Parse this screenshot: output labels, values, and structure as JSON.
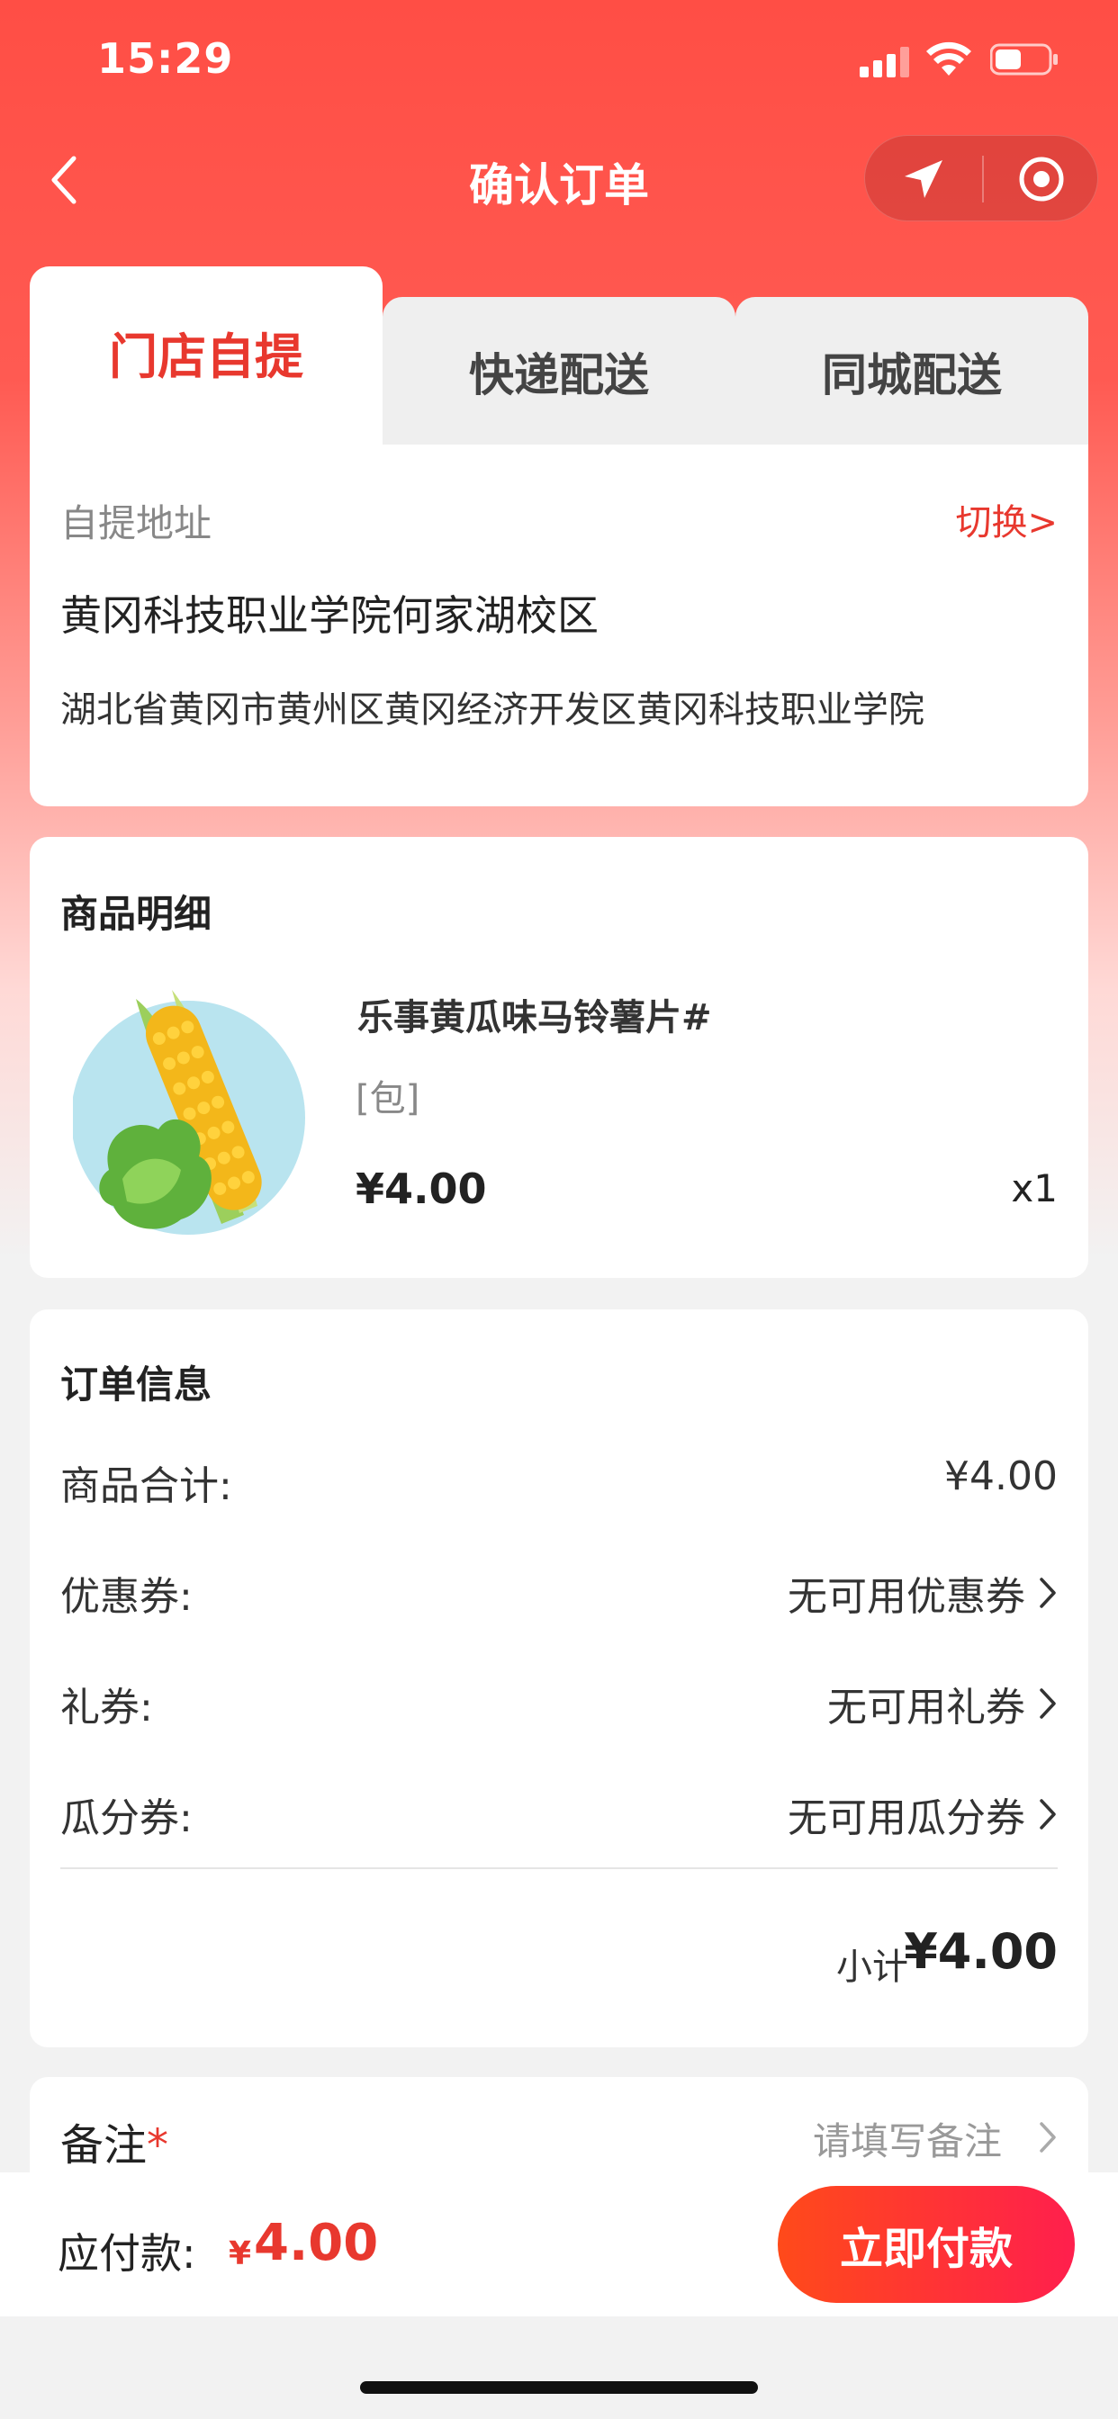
{
  "status_bar": {
    "time": "15:29"
  },
  "nav": {
    "title": "确认订单"
  },
  "tabs": [
    {
      "label": "门店自提",
      "active": true
    },
    {
      "label": "快递配送",
      "active": false
    },
    {
      "label": "同城配送",
      "active": false
    }
  ],
  "address": {
    "label": "自提地址",
    "switch_label": "切换>",
    "name": "黄冈科技职业学院何家湖校区",
    "detail": "湖北省黄冈市黄州区黄冈经济开发区黄冈科技职业学院"
  },
  "product_section": {
    "title": "商品明细",
    "items": [
      {
        "name": "乐事黄瓜味马铃薯片#",
        "unit": "[包]",
        "price": "¥4.00",
        "qty": "x1"
      }
    ]
  },
  "order_info": {
    "title": "订单信息",
    "rows": [
      {
        "label": "商品合计:",
        "value": "¥4.00"
      },
      {
        "label": "优惠券:",
        "value": "无可用优惠券"
      },
      {
        "label": "礼券:",
        "value": "无可用礼券"
      },
      {
        "label": "瓜分券:",
        "value": "无可用瓜分券"
      }
    ],
    "subtotal_label": "小计",
    "subtotal_value": "¥4.00"
  },
  "remark": {
    "label": "备注",
    "required_mark": "*",
    "placeholder": "请填写备注"
  },
  "bottom_bar": {
    "payable_label": "应付款:",
    "currency": "¥",
    "amount": "4.00",
    "pay_button": "立即付款"
  },
  "colors": {
    "primary": "#e8382e",
    "header": "#ff4e45"
  }
}
